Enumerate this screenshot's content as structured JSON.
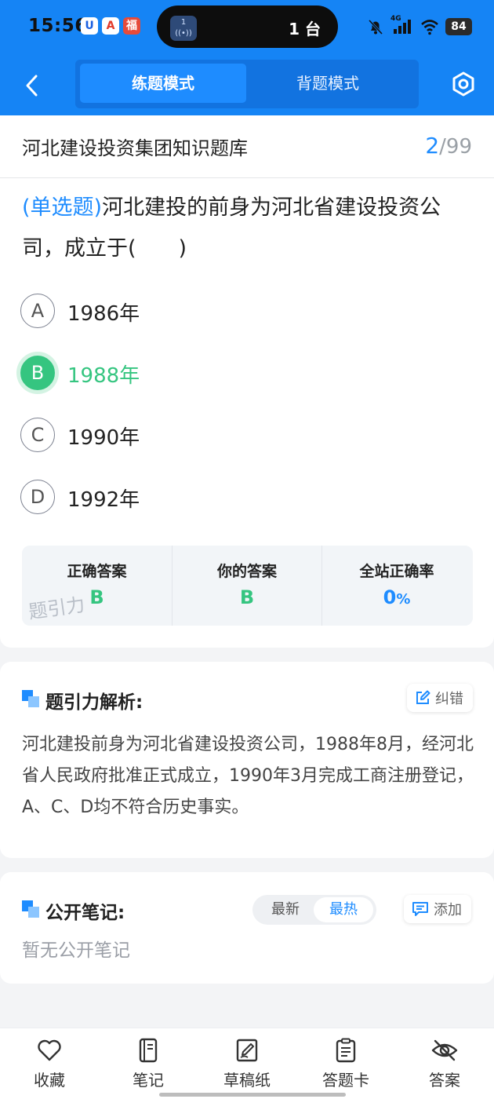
{
  "status_bar": {
    "time": "15:56",
    "island_badge": "1",
    "island_text": "1 台",
    "network": "4G",
    "battery": "84"
  },
  "nav": {
    "mode_practice": "练题模式",
    "mode_recite": "背题模式"
  },
  "bank": {
    "title": "河北建设投资集团知识题库",
    "current": "2",
    "total": "99"
  },
  "question": {
    "type": "(单选题)",
    "text": "河北建投的前身为河北省建设投资公司，成立于(　　)",
    "options": [
      {
        "letter": "A",
        "text": "1986年"
      },
      {
        "letter": "B",
        "text": "1988年"
      },
      {
        "letter": "C",
        "text": "1990年"
      },
      {
        "letter": "D",
        "text": "1992年"
      }
    ]
  },
  "answer_panel": {
    "correct_label": "正确答案",
    "correct_value": "B",
    "yours_label": "你的答案",
    "yours_value": "B",
    "rate_label": "全站正确率",
    "rate_value": "0",
    "rate_unit": "%",
    "watermark": "题引力"
  },
  "analysis": {
    "title": "题引力解析:",
    "correct_btn": "纠错",
    "text": "河北建投前身为河北省建设投资公司，1988年8月，经河北省人民政府批准正式成立，1990年3月完成工商注册登记，A、C、D均不符合历史事实。"
  },
  "notes": {
    "title": "公开笔记:",
    "sort_latest": "最新",
    "sort_hot": "最热",
    "add_btn": "添加",
    "empty": "暂无公开笔记"
  },
  "tabbar": {
    "favorite": "收藏",
    "notes": "笔记",
    "scratch": "草稿纸",
    "answer_card": "答题卡",
    "answer": "答案"
  },
  "colors": {
    "brand_blue": "#1584f5",
    "accent_blue": "#1e8cff",
    "correct_green": "#35c580"
  },
  "icons": {
    "back": "chevron-left-icon",
    "settings": "hexagon-settings-icon",
    "edit": "edit-icon",
    "add_comment": "comment-icon",
    "favorite": "heart-icon",
    "notes": "notebook-icon",
    "scratch": "scratch-pad-icon",
    "answer_card": "clipboard-icon",
    "answer": "eye-off-icon"
  }
}
